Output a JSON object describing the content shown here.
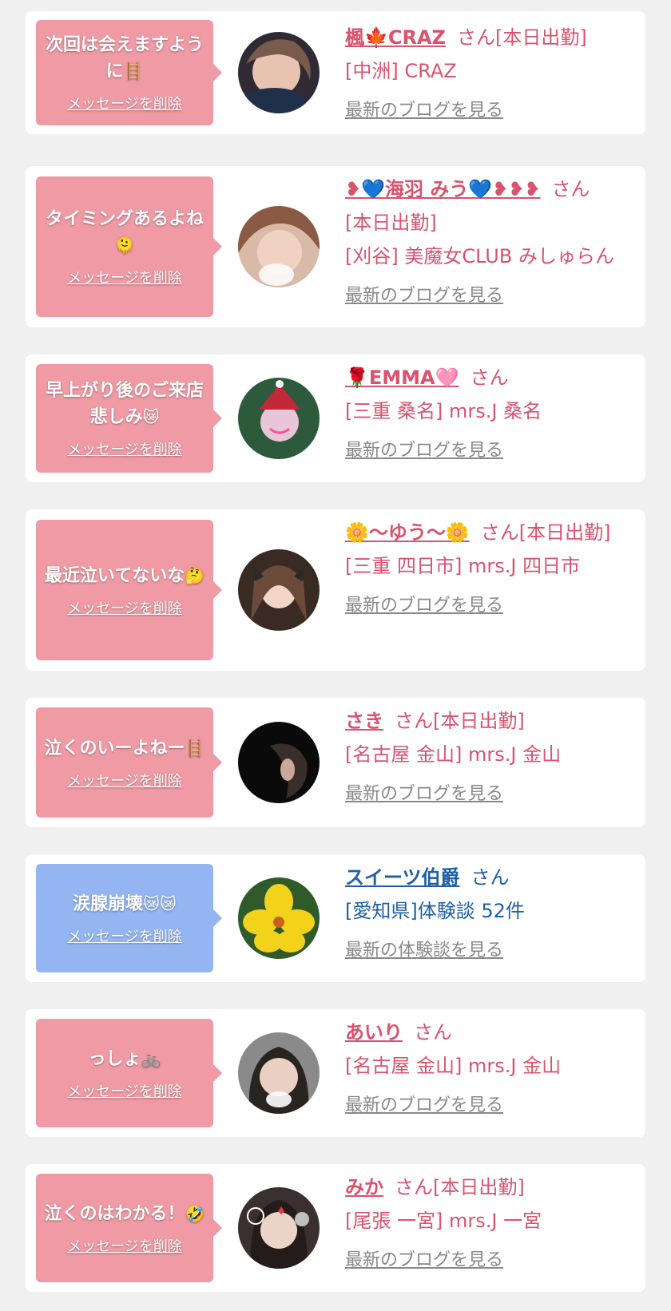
{
  "cards": [
    {
      "message": "次回は会えますように",
      "message_emoji": "🪜",
      "delete_label": "メッセージを削除",
      "name": "楓🍁CRAZ",
      "honorific": "さん",
      "status": "[本日出勤]",
      "shop": "[中洲] CRAZ",
      "link_label": "最新のブログを見る",
      "bubble_color": "#ef9aa4"
    },
    {
      "message": "タイミングあるよね",
      "message_emoji": "🫠",
      "delete_label": "メッセージを削除",
      "name": "❥💙海羽 みう💙❥❥❥",
      "honorific": "さん",
      "status": "[本日出勤]",
      "shop": "[刈谷] 美魔女CLUB みしゅらん",
      "link_label": "最新のブログを見る",
      "bubble_color": "#ef9aa4"
    },
    {
      "message": "早上がり後のご来店悲しみ",
      "message_emoji": "😿",
      "delete_label": "メッセージを削除",
      "name": "🌹EMMA🩷",
      "honorific": "さん",
      "status": "",
      "shop": "[三重 桑名] mrs.J 桑名",
      "link_label": "最新のブログを見る",
      "bubble_color": "#ef9aa4"
    },
    {
      "message": "最近泣いてないな",
      "message_emoji": "🤔",
      "delete_label": "メッセージを削除",
      "name": "🌼〜ゆう〜🌼",
      "honorific": "さん",
      "status": "[本日出勤]",
      "shop": "[三重 四日市] mrs.J 四日市",
      "link_label": "最新のブログを見る",
      "bubble_color": "#ef9aa4"
    },
    {
      "message": "泣くのいーよねー",
      "message_emoji": "🪜",
      "delete_label": "メッセージを削除",
      "name": "さき",
      "honorific": "さん",
      "status": "[本日出勤]",
      "shop": "[名古屋 金山] mrs.J 金山",
      "link_label": "最新のブログを見る",
      "bubble_color": "#ef9aa4"
    },
    {
      "message": "涙腺崩壊",
      "message_emoji": "😿😿",
      "delete_label": "メッセージを削除",
      "name": "スイーツ伯爵",
      "honorific": "さん",
      "status": "",
      "shop": "[愛知県]体験談 52件",
      "link_label": "最新の体験談を見る",
      "bubble_color": "#94b5f2"
    },
    {
      "message": "っしょ",
      "message_emoji": "🚲",
      "delete_label": "メッセージを削除",
      "name": "あいり",
      "honorific": "さん",
      "status": "",
      "shop": "[名古屋 金山] mrs.J 金山",
      "link_label": "最新のブログを見る",
      "bubble_color": "#ef9aa4"
    },
    {
      "message": "泣くのはわかる！",
      "message_emoji": "🤣",
      "delete_label": "メッセージを削除",
      "name": "みか",
      "honorific": "さん",
      "status": "[本日出勤]",
      "shop": "[尾張 一宮] mrs.J 一宮",
      "link_label": "最新のブログを見る",
      "bubble_color": "#ef9aa4"
    }
  ]
}
